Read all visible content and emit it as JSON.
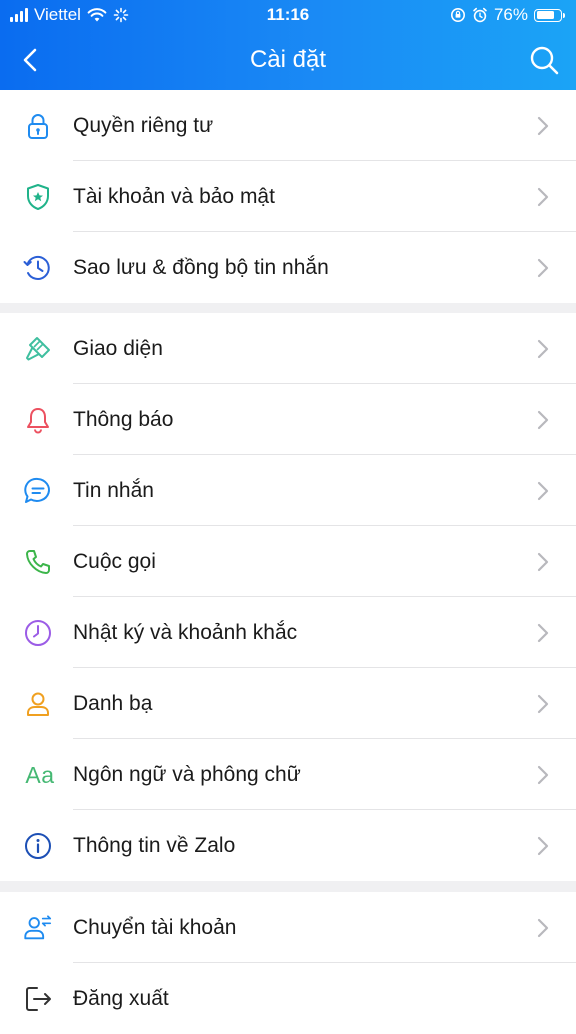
{
  "status_bar": {
    "carrier": "Viettel",
    "time": "11:16",
    "battery_percent": "76%",
    "battery_level": 0.76
  },
  "nav": {
    "title": "Cài đặt",
    "back_icon": "chevron-left-icon",
    "search_icon": "search-icon"
  },
  "groups": [
    {
      "items": [
        {
          "label": "Quyền riêng tư",
          "icon": "lock-icon",
          "color": "#1f8bf0"
        },
        {
          "label": "Tài khoản và bảo mật",
          "icon": "shield-icon",
          "color": "#20b38a"
        },
        {
          "label": "Sao lưu & đồng bộ tin nhắn",
          "icon": "history-clock-icon",
          "color": "#2b5fd6"
        }
      ]
    },
    {
      "items": [
        {
          "label": "Giao diện",
          "icon": "paint-brush-icon",
          "color": "#3fbf9f"
        },
        {
          "label": "Thông báo",
          "icon": "bell-icon",
          "color": "#ec5160"
        },
        {
          "label": "Tin nhắn",
          "icon": "chat-bubble-icon",
          "color": "#1f8bf0"
        },
        {
          "label": "Cuộc gọi",
          "icon": "phone-icon",
          "color": "#3cb54a"
        },
        {
          "label": "Nhật ký và khoảnh khắc",
          "icon": "clock-icon",
          "color": "#9b5ce6"
        },
        {
          "label": "Danh bạ",
          "icon": "contact-person-icon",
          "color": "#f0a020"
        },
        {
          "label": "Ngôn ngữ và phông chữ",
          "icon": "font-aa-icon",
          "color": "#45b873",
          "glyph": "Aa"
        },
        {
          "label": "Thông tin về Zalo",
          "icon": "info-icon",
          "color": "#1c4fb5"
        }
      ]
    },
    {
      "items": [
        {
          "label": "Chuyển tài khoản",
          "icon": "switch-account-icon",
          "color": "#1f8bf0"
        },
        {
          "label": "Đăng xuất",
          "icon": "logout-icon",
          "color": "#333333"
        }
      ]
    }
  ]
}
